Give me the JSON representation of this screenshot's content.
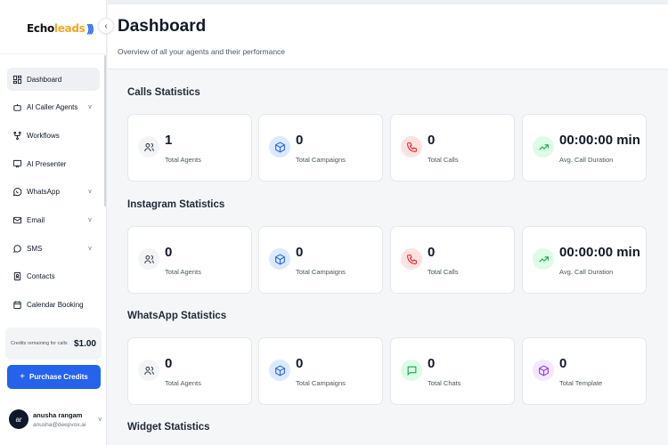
{
  "brand": {
    "logo_echo": "Echo",
    "logo_leads": "leads",
    "logo_waves": ")))"
  },
  "collapse_icon": "‹",
  "sidebar": {
    "items": [
      {
        "label": "Dashboard",
        "icon": "dashboard-icon",
        "active": true,
        "chevron": ""
      },
      {
        "label": "AI Caller Agents",
        "icon": "bot-icon",
        "active": false,
        "chevron": "v"
      },
      {
        "label": "Workflows",
        "icon": "workflow-icon",
        "active": false,
        "chevron": ""
      },
      {
        "label": "AI Presenter",
        "icon": "presenter-icon",
        "active": false,
        "chevron": ""
      },
      {
        "label": "WhatsApp",
        "icon": "whatsapp-icon",
        "active": false,
        "chevron": "v"
      },
      {
        "label": "Email",
        "icon": "email-icon",
        "active": false,
        "chevron": "v"
      },
      {
        "label": "SMS",
        "icon": "sms-icon",
        "active": false,
        "chevron": "v"
      },
      {
        "label": "Contacts",
        "icon": "contacts-icon",
        "active": false,
        "chevron": ""
      },
      {
        "label": "Calendar Booking",
        "icon": "calendar-icon",
        "active": false,
        "chevron": ""
      }
    ],
    "credits_label": "Credits remaining for calls",
    "credits_value": "$1.00",
    "purchase_plus": "+",
    "purchase_label": "Purchase Credits",
    "user": {
      "initials": "ar",
      "name": "anusha rangam",
      "email": "anusha@deepvox.ai",
      "chevron": "v"
    }
  },
  "header": {
    "title": "Dashboard",
    "subtitle": "Overview of all your agents and their performance"
  },
  "sections": [
    {
      "title": "Calls Statistics",
      "cards": [
        {
          "value": "1",
          "label": "Total Agents",
          "icon": "users-icon",
          "color": "gray"
        },
        {
          "value": "0",
          "label": "Total Campaigns",
          "icon": "cube-icon",
          "color": "blue"
        },
        {
          "value": "0",
          "label": "Total Calls",
          "icon": "phone-icon",
          "color": "red"
        },
        {
          "value": "00:00:00 min",
          "label": "Avg. Call Duration",
          "icon": "trend-up-icon",
          "color": "green"
        }
      ]
    },
    {
      "title": "Instagram Statistics",
      "cards": [
        {
          "value": "0",
          "label": "Total Agents",
          "icon": "users-icon",
          "color": "gray"
        },
        {
          "value": "0",
          "label": "Total Campaigns",
          "icon": "cube-icon",
          "color": "blue"
        },
        {
          "value": "0",
          "label": "Total Calls",
          "icon": "phone-icon",
          "color": "red"
        },
        {
          "value": "00:00:00 min",
          "label": "Avg. Call Duration",
          "icon": "trend-up-icon",
          "color": "green"
        }
      ]
    },
    {
      "title": "WhatsApp Statistics",
      "cards": [
        {
          "value": "0",
          "label": "Total Agents",
          "icon": "users-icon",
          "color": "gray"
        },
        {
          "value": "0",
          "label": "Total Campaigns",
          "icon": "cube-icon",
          "color": "blue"
        },
        {
          "value": "0",
          "label": "Total Chats",
          "icon": "chat-icon",
          "color": "green"
        },
        {
          "value": "0",
          "label": "Total Template",
          "icon": "cube-icon",
          "color": "purple"
        }
      ]
    },
    {
      "title": "Widget Statistics",
      "cards": []
    }
  ],
  "colors": {
    "accent": "#2563eb",
    "logo_accent": "#f5a623",
    "active_nav": "#eef0f3"
  }
}
